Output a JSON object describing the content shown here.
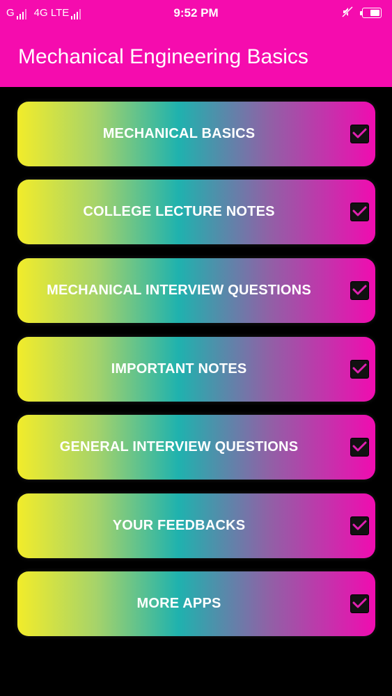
{
  "status_bar": {
    "network1": "G",
    "network2": "4G LTE",
    "time": "9:52 PM",
    "icons": [
      "signal-icon",
      "signal-icon",
      "mute-icon",
      "battery-icon"
    ]
  },
  "app_bar": {
    "title": "Mechanical Engineering Basics"
  },
  "menu": {
    "items": [
      {
        "label": "MECHANICAL BASICS",
        "checked": true
      },
      {
        "label": "COLLEGE LECTURE NOTES",
        "checked": true
      },
      {
        "label": "MECHANICAL INTERVIEW QUESTIONS",
        "checked": true
      },
      {
        "label": "IMPORTANT NOTES",
        "checked": true
      },
      {
        "label": "GENERAL INTERVIEW QUESTIONS",
        "checked": true
      },
      {
        "label": "YOUR FEEDBACKS",
        "checked": true
      },
      {
        "label": "MORE APPS",
        "checked": true
      }
    ]
  },
  "colors": {
    "app_bar": "#f50cae",
    "background": "#000000",
    "gradient_start": "#f2ec2a",
    "gradient_mid": "#1fb2ae",
    "gradient_end": "#f00cb0",
    "check_mark": "#e020b0"
  }
}
